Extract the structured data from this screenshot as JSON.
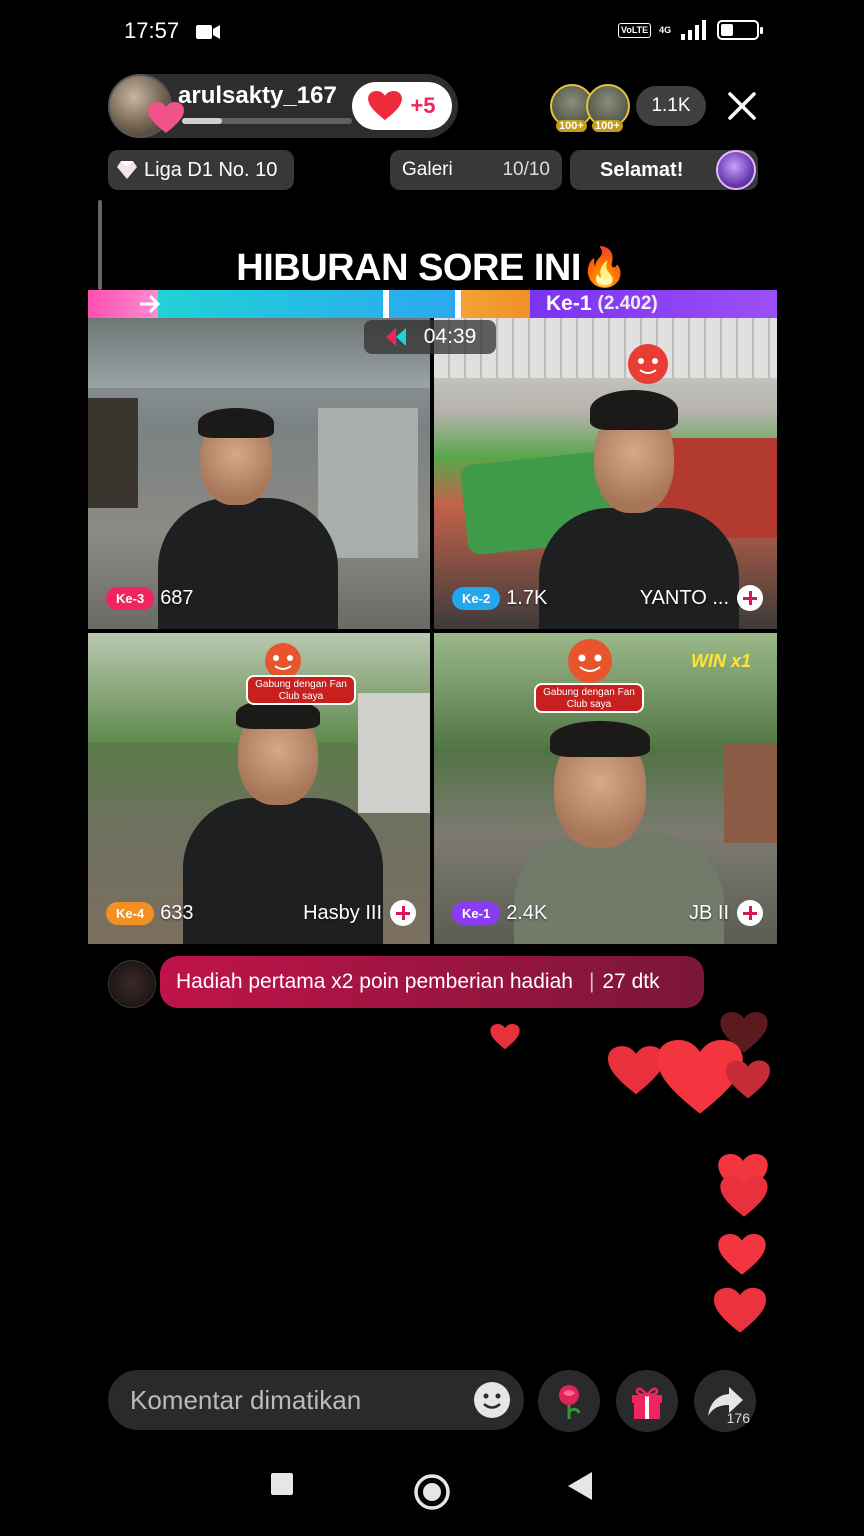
{
  "status_bar": {
    "time": "17:57",
    "network_badge": "VoLTE",
    "network_type": "4G",
    "battery_percent": 35
  },
  "host": {
    "username": "arulsakty_167",
    "follow_count": "+5"
  },
  "viewers": {
    "badges": [
      "100+",
      "100+"
    ],
    "count": "1.1K"
  },
  "top_row": {
    "league": "Liga D1 No. 10",
    "gallery_label": "Galeri",
    "gallery_value": "10/10",
    "congrats_label": "Selamat!"
  },
  "stream_title": "HIBURAN SORE INI🔥",
  "battle": {
    "rank_label": "Ke-1",
    "rank_score": "(2.402)",
    "timer": "04:39",
    "colors": {
      "pink": "#f0245e",
      "blue": "#22a6ee",
      "orange": "#f29024",
      "purple": "#8a3cf2"
    }
  },
  "players": [
    {
      "rank": "Ke-3",
      "score": "687",
      "name": ""
    },
    {
      "rank": "Ke-2",
      "score": "1.7K",
      "name": "YANTO ..."
    },
    {
      "rank": "Ke-4",
      "score": "633",
      "name": "Hasby III"
    },
    {
      "rank": "Ke-1",
      "score": "2.4K",
      "name": "JB II",
      "win": "WIN x1"
    }
  ],
  "mascot_label": "Gabung dengan Fan Club saya",
  "banner": {
    "text": "Hadiah pertama x2 poin pemberian hadiah",
    "countdown": "27 dtk"
  },
  "bottom_bar": {
    "comment_placeholder": "Komentar dimatikan",
    "share_count": "176"
  },
  "icons": [
    "video-camera-icon",
    "battery-icon",
    "heart-icon",
    "close-icon",
    "diamond-icon",
    "timer-icon",
    "plus-icon",
    "emoji-icon",
    "rose-icon",
    "gift-icon",
    "share-icon",
    "nav-recents-icon",
    "nav-home-icon",
    "nav-back-icon"
  ]
}
